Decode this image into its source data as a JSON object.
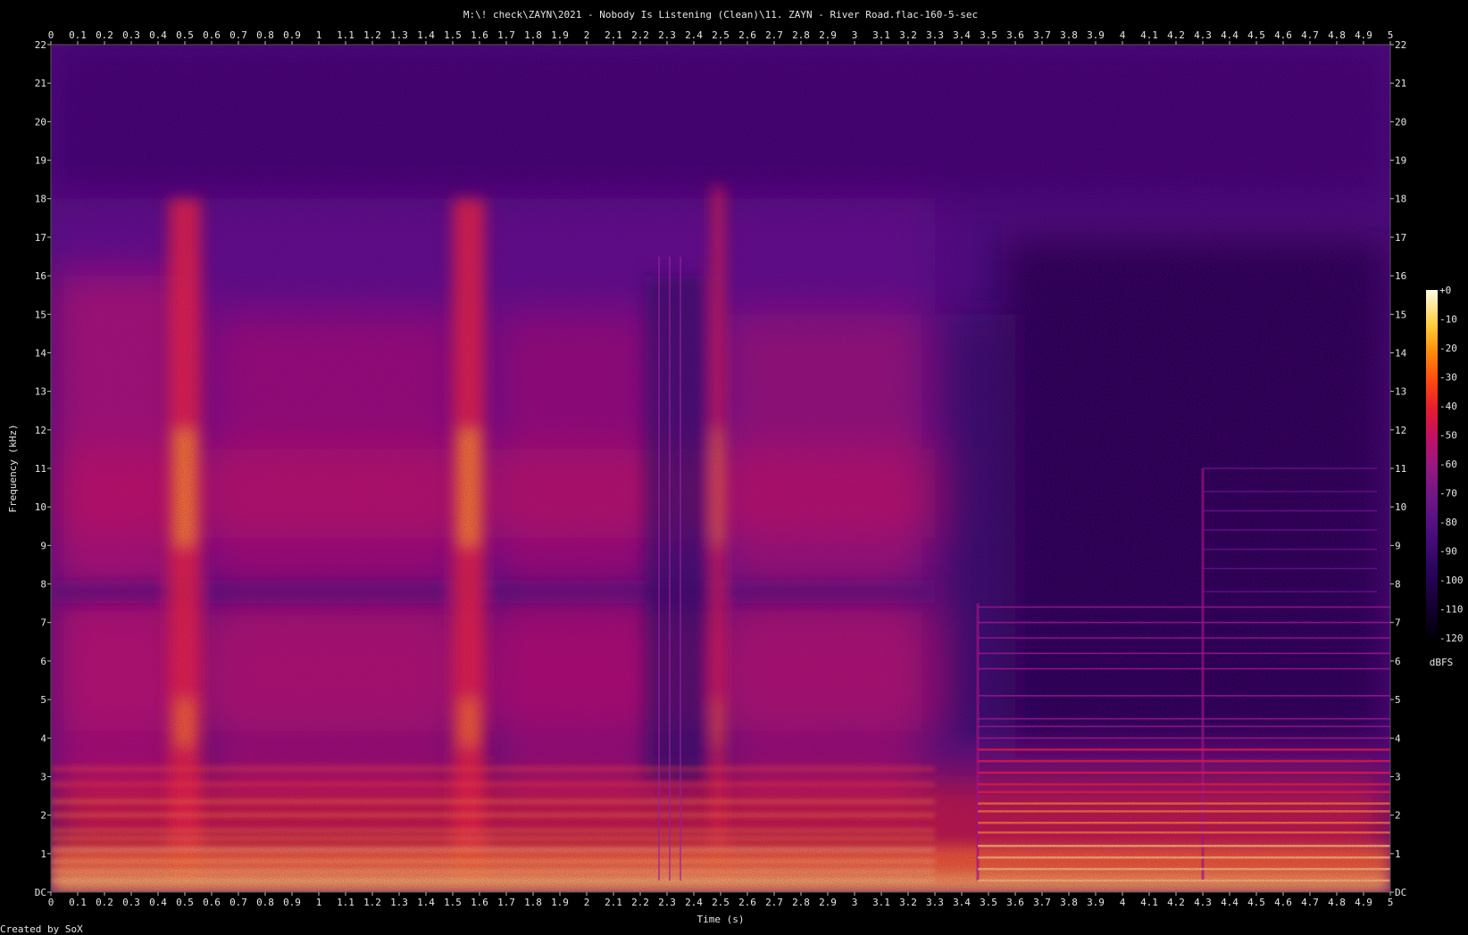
{
  "chart_data": {
    "type": "heatmap",
    "title": "M:\\! check\\ZAYN\\2021 - Nobody Is Listening (Clean)\\11. ZAYN - River Road.flac-160-5-sec",
    "xlabel": "Time (s)",
    "ylabel": "Frequency (kHz)",
    "xlim": [
      0,
      5
    ],
    "ylim": [
      0,
      22
    ],
    "x_ticks": [
      "0",
      "0.1",
      "0.2",
      "0.3",
      "0.4",
      "0.5",
      "0.6",
      "0.7",
      "0.8",
      "0.9",
      "1",
      "1.1",
      "1.2",
      "1.3",
      "1.4",
      "1.5",
      "1.6",
      "1.7",
      "1.8",
      "1.9",
      "2",
      "2.1",
      "2.2",
      "2.3",
      "2.4",
      "2.5",
      "2.6",
      "2.7",
      "2.8",
      "2.9",
      "3",
      "3.1",
      "3.2",
      "3.3",
      "3.4",
      "3.5",
      "3.6",
      "3.7",
      "3.8",
      "3.9",
      "4",
      "4.1",
      "4.2",
      "4.3",
      "4.4",
      "4.5",
      "4.6",
      "4.7",
      "4.8",
      "4.9",
      "5"
    ],
    "y_ticks": [
      "DC",
      "1",
      "2",
      "3",
      "4",
      "5",
      "6",
      "7",
      "8",
      "9",
      "10",
      "11",
      "12",
      "13",
      "14",
      "15",
      "16",
      "17",
      "18",
      "19",
      "20",
      "21",
      "22"
    ],
    "colorbar": {
      "label": "dBFS",
      "ticks": [
        "+0",
        "-10",
        "-20",
        "-30",
        "-40",
        "-50",
        "-60",
        "-70",
        "-80",
        "-90",
        "-100",
        "-110",
        "-120"
      ],
      "range": [
        -120,
        0
      ],
      "colors": [
        "#050014",
        "#1a0042",
        "#3a0a6a",
        "#5a1482",
        "#801a8a",
        "#a8187a",
        "#d0145a",
        "#ee2428",
        "#ff5a10",
        "#ff9a08",
        "#ffd640",
        "#fff6c8"
      ]
    },
    "features": {
      "transients_s": [
        0.5,
        1.56,
        2.3,
        2.49,
        3.46,
        4.3
      ],
      "energy_cutoff_khz": 18,
      "quiet_region_s": [
        3.5,
        4.3
      ]
    },
    "footer": "Created by SoX"
  }
}
